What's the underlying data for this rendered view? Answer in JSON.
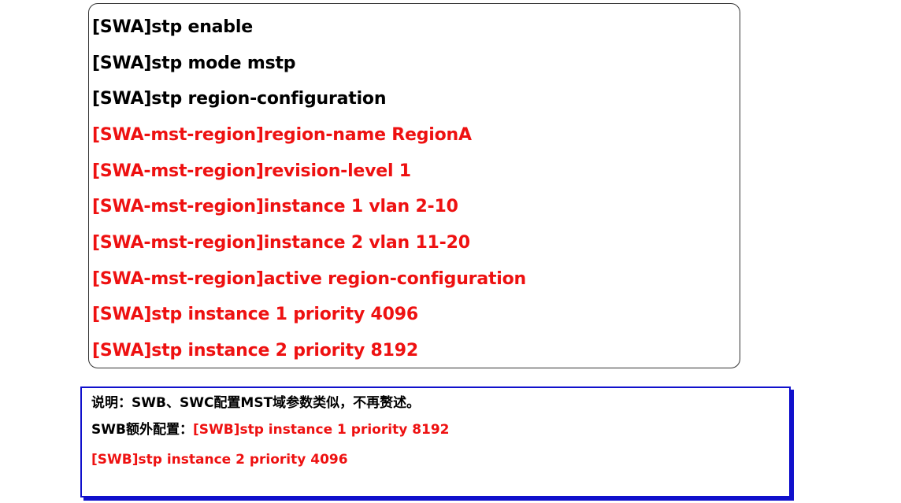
{
  "commands": [
    {
      "text": "[SWA]stp enable",
      "color": "#000000"
    },
    {
      "text": "[SWA]stp mode mstp",
      "color": "#000000"
    },
    {
      "text": "[SWA]stp region-configuration",
      "color": "#000000"
    },
    {
      "text": "[SWA-mst-region]region-name RegionA",
      "color": "#ee1111"
    },
    {
      "text": "[SWA-mst-region]revision-level 1",
      "color": "#ee1111"
    },
    {
      "text": "[SWA-mst-region]instance 1 vlan 2-10",
      "color": "#ee1111"
    },
    {
      "text": "[SWA-mst-region]instance 2 vlan 11-20",
      "color": "#ee1111"
    },
    {
      "text": "[SWA-mst-region]active region-configuration",
      "color": "#ee1111"
    },
    {
      "text": "[SWA]stp instance 1 priority 4096",
      "color": "#ee1111"
    },
    {
      "text": "[SWA]stp instance 2 priority 8192",
      "color": "#ee1111"
    }
  ],
  "note": {
    "line1": "说明：SWB、SWC配置MST域参数类似，不再赘述。",
    "line2_label": "SWB额外配置：",
    "line2_cmd": "[SWB]stp instance 1 priority 8192",
    "line3_cmd": "[SWB]stp instance 2 priority 4096",
    "border_color": "#1010cc"
  }
}
